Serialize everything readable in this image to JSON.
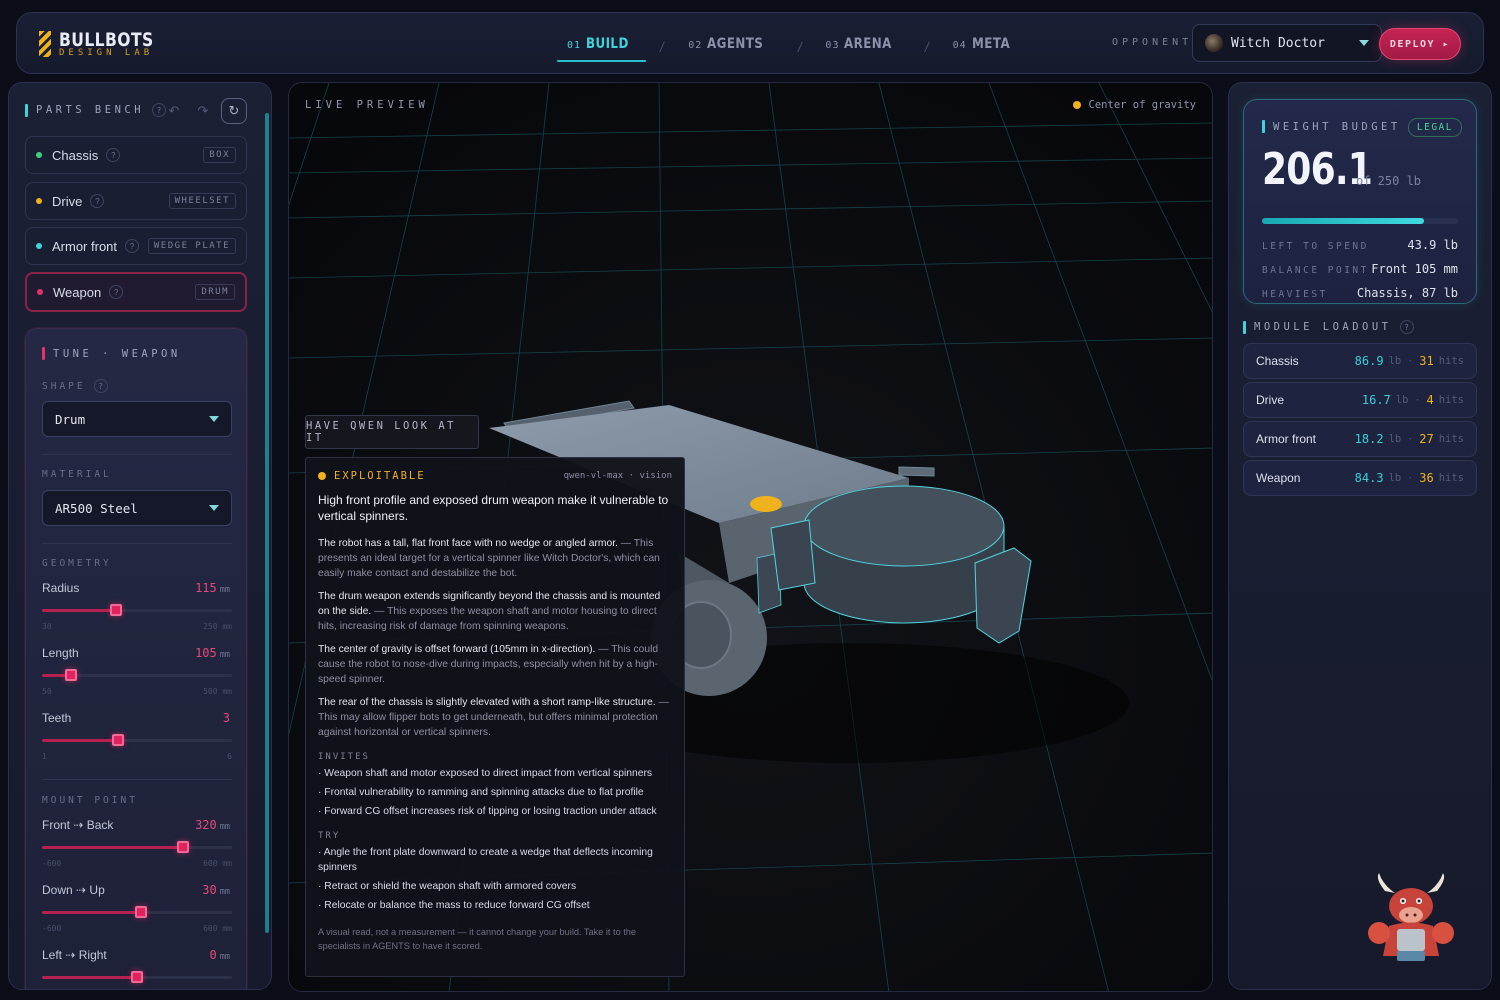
{
  "brand": {
    "title": "BULLBOTS",
    "subtitle": "DESIGN LAB"
  },
  "nav": {
    "tabs": [
      {
        "num": "01",
        "label": "BUILD",
        "active": true
      },
      {
        "num": "02",
        "label": "AGENTS",
        "active": false
      },
      {
        "num": "03",
        "label": "ARENA",
        "active": false
      },
      {
        "num": "04",
        "label": "META",
        "active": false
      }
    ],
    "separator": "/"
  },
  "opponent": {
    "label": "OPPONENT",
    "selected": "Witch Doctor"
  },
  "deploy": {
    "label": "DEPLOY ▸"
  },
  "parts_bench": {
    "title": "PARTS BENCH",
    "help": "?",
    "parts": [
      {
        "name": "Chassis",
        "tag": "BOX",
        "dot_color": "#3fd07e"
      },
      {
        "name": "Drive",
        "tag": "WHEELSET",
        "dot_color": "#f0b21c"
      },
      {
        "name": "Armor front",
        "tag": "WEDGE PLATE",
        "dot_color": "#3fd4da"
      },
      {
        "name": "Weapon",
        "tag": "DRUM",
        "dot_color": "#e2356b"
      }
    ]
  },
  "tune": {
    "title": "TUNE · WEAPON",
    "shape_label": "SHAPE",
    "shape_value": "Drum",
    "material_label": "MATERIAL",
    "material_value": "AR500 Steel",
    "geometry_label": "GEOMETRY",
    "geometry": [
      {
        "label": "Radius",
        "value": "115",
        "unit": "mm",
        "min": "30",
        "max": "250 mm",
        "fraction": 0.39
      },
      {
        "label": "Length",
        "value": "105",
        "unit": "mm",
        "min": "50",
        "max": "500 mm",
        "fraction": 0.15
      },
      {
        "label": "Teeth",
        "value": "3",
        "unit": "",
        "min": "1",
        "max": "6",
        "fraction": 0.4
      }
    ],
    "mount_label": "MOUNT POINT",
    "mount": [
      {
        "label": "Front ⇢ Back",
        "value": "320",
        "unit": "mm",
        "min": "-600",
        "max": "600 mm",
        "fraction": 0.74
      },
      {
        "label": "Down ⇢ Up",
        "value": "30",
        "unit": "mm",
        "min": "-600",
        "max": "600 mm",
        "fraction": 0.52
      },
      {
        "label": "Left ⇢ Right",
        "value": "0",
        "unit": "mm",
        "min": "",
        "max": "",
        "fraction": 0.5
      }
    ]
  },
  "preview": {
    "label": "LIVE PREVIEW",
    "legend": "Center of gravity",
    "qwen_button": "HAVE QWEN LOOK AT IT"
  },
  "analysis": {
    "status": "EXPLOITABLE",
    "model": "qwen-vl-max · vision",
    "headline": "High front profile and exposed drum weapon make it vulnerable to vertical spinners.",
    "findings": [
      {
        "lead": "The robot has a tall, flat front face with no wedge or angled armor.",
        "detail": " — This presents an ideal target for a vertical spinner like Witch Doctor's, which can easily make contact and destabilize the bot."
      },
      {
        "lead": "The drum weapon extends significantly beyond the chassis and is mounted on the side.",
        "detail": " — This exposes the weapon shaft and motor housing to direct hits, increasing risk of damage from spinning weapons."
      },
      {
        "lead": "The center of gravity is offset forward (105mm in x-direction).",
        "detail": " — This could cause the robot to nose-dive during impacts, especially when hit by a high-speed spinner."
      },
      {
        "lead": "The rear of the chassis is slightly elevated with a short ramp-like structure.",
        "detail": " — This may allow flipper bots to get underneath, but offers minimal protection against horizontal or vertical spinners."
      }
    ],
    "invites_label": "INVITES",
    "invites": [
      "· Weapon shaft and motor exposed to direct impact from vertical spinners",
      "· Frontal vulnerability to ramming and spinning attacks due to flat profile",
      "· Forward CG offset increases risk of tipping or losing traction under attack"
    ],
    "try_label": "TRY",
    "try": [
      "· Angle the front plate downward to create a wedge that deflects incoming spinners",
      "· Retract or shield the weapon shaft with armored covers",
      "· Relocate or balance the mass to reduce forward CG offset"
    ],
    "footer": "A visual read, not a measurement — it cannot change your build. Take it to the specialists in AGENTS to have it scored."
  },
  "weight_budget": {
    "title": "WEIGHT BUDGET",
    "badge": "LEGAL",
    "value": "206.1",
    "of": "of 250 lb",
    "fraction": 0.824,
    "stats": [
      {
        "key": "LEFT TO SPEND",
        "value": "43.9 lb"
      },
      {
        "key": "BALANCE POINT",
        "value": "Front 105 mm"
      },
      {
        "key": "HEAVIEST",
        "value": "Chassis, 87 lb"
      }
    ]
  },
  "module_loadout": {
    "title": "MODULE LOADOUT",
    "modules": [
      {
        "name": "Chassis",
        "weight": "86.9",
        "unit": "lb",
        "sep": "·",
        "hits": "31",
        "hits_label": "hits"
      },
      {
        "name": "Drive",
        "weight": "16.7",
        "unit": "lb",
        "sep": "·",
        "hits": "4",
        "hits_label": "hits"
      },
      {
        "name": "Armor front",
        "weight": "18.2",
        "unit": "lb",
        "sep": "·",
        "hits": "27",
        "hits_label": "hits"
      },
      {
        "name": "Weapon",
        "weight": "84.3",
        "unit": "lb",
        "sep": "·",
        "hits": "36",
        "hits_label": "hits"
      }
    ]
  },
  "colors": {
    "accent": "#3fd4da",
    "danger": "#e2356b",
    "warn": "#f0b21c",
    "legal": "#49d39b"
  }
}
